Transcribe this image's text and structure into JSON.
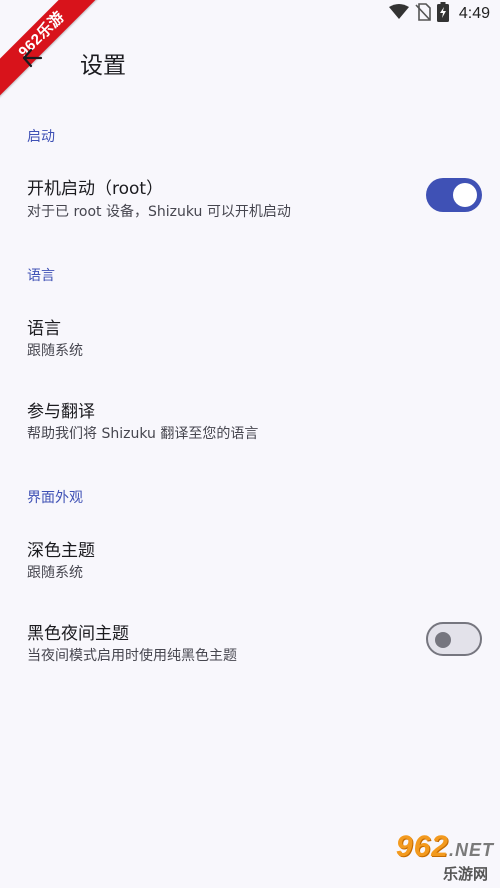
{
  "status_bar": {
    "time": "4:49",
    "icons": [
      "wifi-icon",
      "no-sim-icon",
      "battery-charging-icon"
    ]
  },
  "corner_badge": {
    "text": "962乐游"
  },
  "app_bar": {
    "back_icon": "arrow-left-icon",
    "title": "设置"
  },
  "sections": {
    "startup": {
      "header": "启动",
      "boot_start": {
        "title": "开机启动（root）",
        "summary": "对于已 root 设备，Shizuku 可以开机启动",
        "switch_on": true
      }
    },
    "language": {
      "header": "语言",
      "language_item": {
        "title": "语言",
        "summary": "跟随系统"
      },
      "translate_item": {
        "title": "参与翻译",
        "summary": "帮助我们将 Shizuku 翻译至您的语言"
      }
    },
    "appearance": {
      "header": "界面外观",
      "dark_theme": {
        "title": "深色主题",
        "summary": "跟随系统"
      },
      "black_night": {
        "title": "黑色夜间主题",
        "summary": "当夜间模式启用时使用纯黑色主题",
        "switch_on": false
      }
    }
  },
  "watermark": {
    "main": "962",
    "net": ".NET",
    "sub": "乐游网"
  },
  "colors": {
    "accent": "#3f51b5",
    "background": "#f8f7fc",
    "badge": "#d8131b"
  }
}
